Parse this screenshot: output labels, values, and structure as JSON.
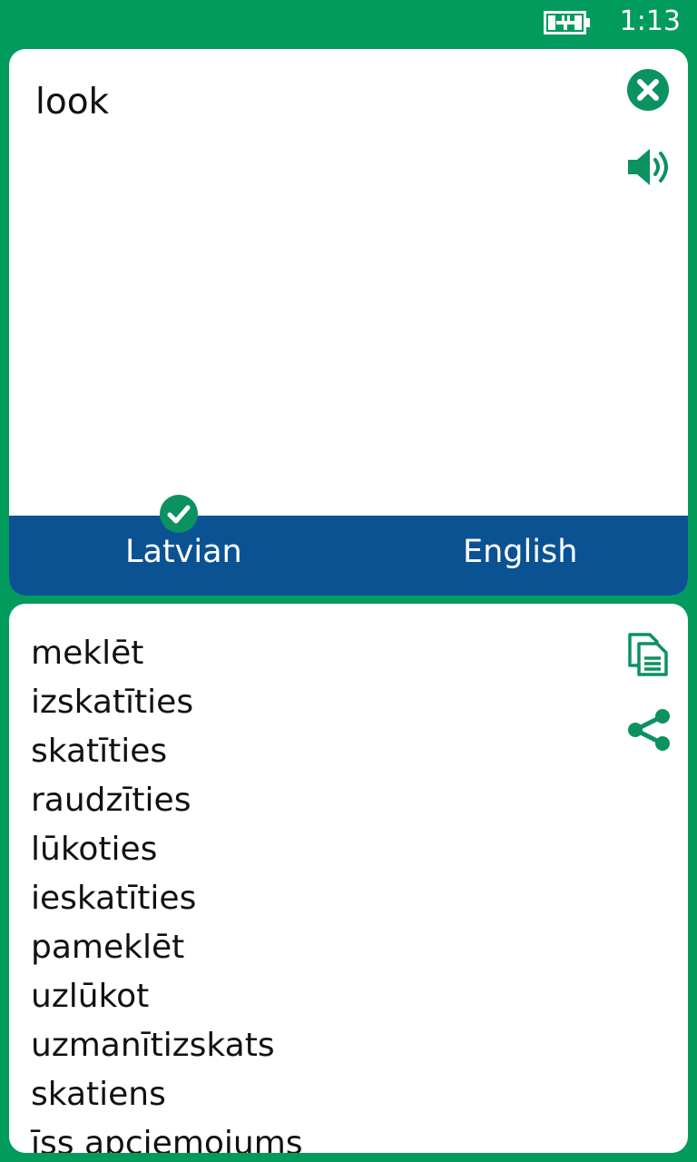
{
  "status_bar": {
    "battery_icon": "battery-charging-icon",
    "time": "1:13"
  },
  "input": {
    "text": "look",
    "clear_icon": "close-circle-icon",
    "speak_icon": "speaker-icon"
  },
  "languages": {
    "source": "Latvian",
    "target": "English",
    "selected_icon": "check-circle-icon"
  },
  "output": {
    "copy_icon": "copy-icon",
    "share_icon": "share-icon",
    "results": [
      "meklēt",
      "izskatīties",
      "skatīties",
      "raudzīties",
      "lūkoties",
      "ieskatīties",
      "pameklēt",
      "uzlūkot",
      "uzmanītizskats",
      "skatiens",
      "īss apciemojums"
    ]
  },
  "colors": {
    "background": "#009b5d",
    "accent": "#0b9260",
    "language_bar": "#0b5293",
    "card": "#ffffff"
  }
}
